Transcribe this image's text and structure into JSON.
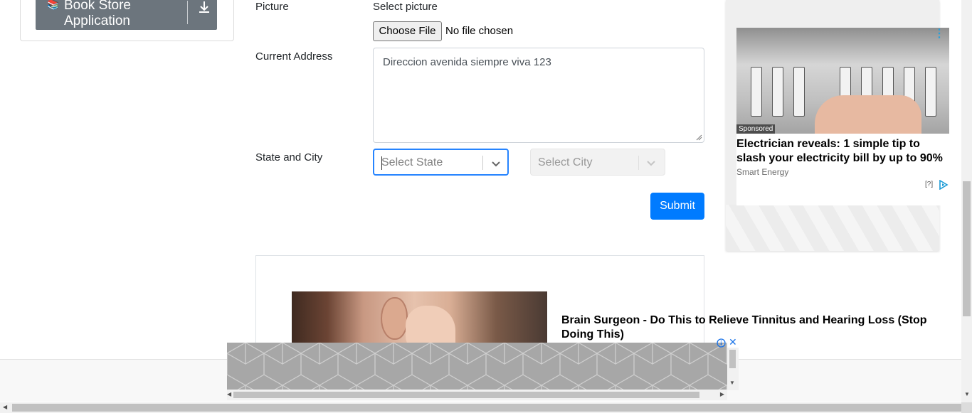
{
  "sidebar": {
    "group_title_line1": "Book Store",
    "group_title_line2": "Application",
    "group_icon": "book-icon",
    "toggle_icon": "download-icon"
  },
  "form": {
    "picture_label": "Picture",
    "picture_prompt": "Select picture",
    "file_button": "Choose File",
    "file_status": "No file chosen",
    "address_label": "Current Address",
    "address_value": "Direccion avenida siempre viva 123",
    "state_city_label": "State and City",
    "state_placeholder": "Select State",
    "city_placeholder": "Select City",
    "submit_label": "Submit"
  },
  "ads": {
    "right": {
      "badge": "Sponsored",
      "headline": "Electrician reveals: 1 simple tip to slash your electricity bill by up to 90%",
      "brand": "Smart Energy",
      "help": "[?]"
    },
    "lower": {
      "headline": "Brain Surgeon - Do This to Relieve Tinnitus and Hearing Loss (Stop Doing This)"
    }
  },
  "colors": {
    "primary": "#007bff",
    "focus_border": "#2684ff",
    "sidebar_group": "#6c757d"
  }
}
